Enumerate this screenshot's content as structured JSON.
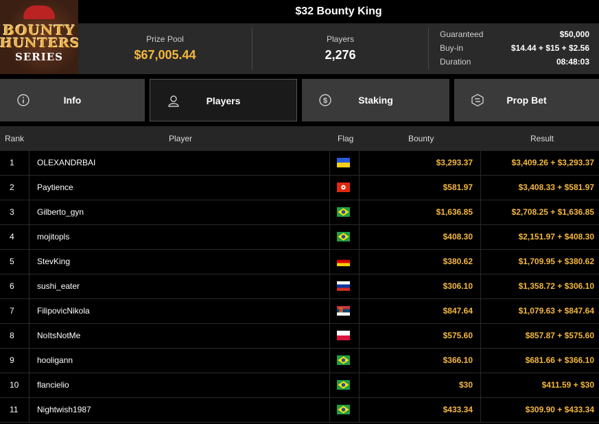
{
  "title": "$32 Bounty King",
  "logo": {
    "line1": "BOUNTY",
    "line2": "HUNTERS",
    "line3": "SERIES"
  },
  "prize_pool": {
    "label": "Prize Pool",
    "value": "$67,005.44"
  },
  "players": {
    "label": "Players",
    "value": "2,276"
  },
  "details": [
    {
      "label": "Guaranteed",
      "value": "$50,000"
    },
    {
      "label": "Buy-in",
      "value": "$14.44 + $15 + $2.56"
    },
    {
      "label": "Duration",
      "value": "08:48:03"
    }
  ],
  "tabs": [
    {
      "label": "Info",
      "icon": "info-icon"
    },
    {
      "label": "Players",
      "icon": "user-icon",
      "active": true
    },
    {
      "label": "Staking",
      "icon": "dollar-coin-icon"
    },
    {
      "label": "Prop Bet",
      "icon": "prop-bet-icon"
    }
  ],
  "columns": {
    "rank": "Rank",
    "player": "Player",
    "flag": "Flag",
    "bounty": "Bounty",
    "result": "Result"
  },
  "rows": [
    {
      "rank": "1",
      "player": "OLEXANDRBAI",
      "flag": "ukraine",
      "bounty": "$3,293.37",
      "result": "$3,409.26 + $3,293.37"
    },
    {
      "rank": "2",
      "player": "Paytience",
      "flag": "hong-kong",
      "bounty": "$581.97",
      "result": "$3,408.33 + $581.97"
    },
    {
      "rank": "3",
      "player": "Gilberto_gyn",
      "flag": "brazil",
      "bounty": "$1,636.85",
      "result": "$2,708.25 + $1,636.85"
    },
    {
      "rank": "4",
      "player": "mojitopls",
      "flag": "brazil",
      "bounty": "$408.30",
      "result": "$2,151.97 + $408.30"
    },
    {
      "rank": "5",
      "player": "StevKing",
      "flag": "germany",
      "bounty": "$380.62",
      "result": "$1,709.95 + $380.62"
    },
    {
      "rank": "6",
      "player": "sushi_eater",
      "flag": "russia",
      "bounty": "$306.10",
      "result": "$1,358.72 + $306.10"
    },
    {
      "rank": "7",
      "player": "FilipovicNikola",
      "flag": "serbia",
      "bounty": "$847.64",
      "result": "$1,079.63 + $847.64"
    },
    {
      "rank": "8",
      "player": "NoItsNotMe",
      "flag": "poland",
      "bounty": "$575.60",
      "result": "$857.87 + $575.60"
    },
    {
      "rank": "9",
      "player": "hooligann",
      "flag": "brazil",
      "bounty": "$366.10",
      "result": "$681.66 + $366.10"
    },
    {
      "rank": "10",
      "player": "flancielio",
      "flag": "brazil",
      "bounty": "$30",
      "result": "$411.59 + $30"
    },
    {
      "rank": "11",
      "player": "Nightwish1987",
      "flag": "brazil",
      "bounty": "$433.34",
      "result": "$309.90 + $433.34"
    }
  ],
  "colors": {
    "accent_gold": "#f5b83d",
    "tab_bg": "#3a3a3a",
    "header_bg": "#2a2a2a"
  }
}
